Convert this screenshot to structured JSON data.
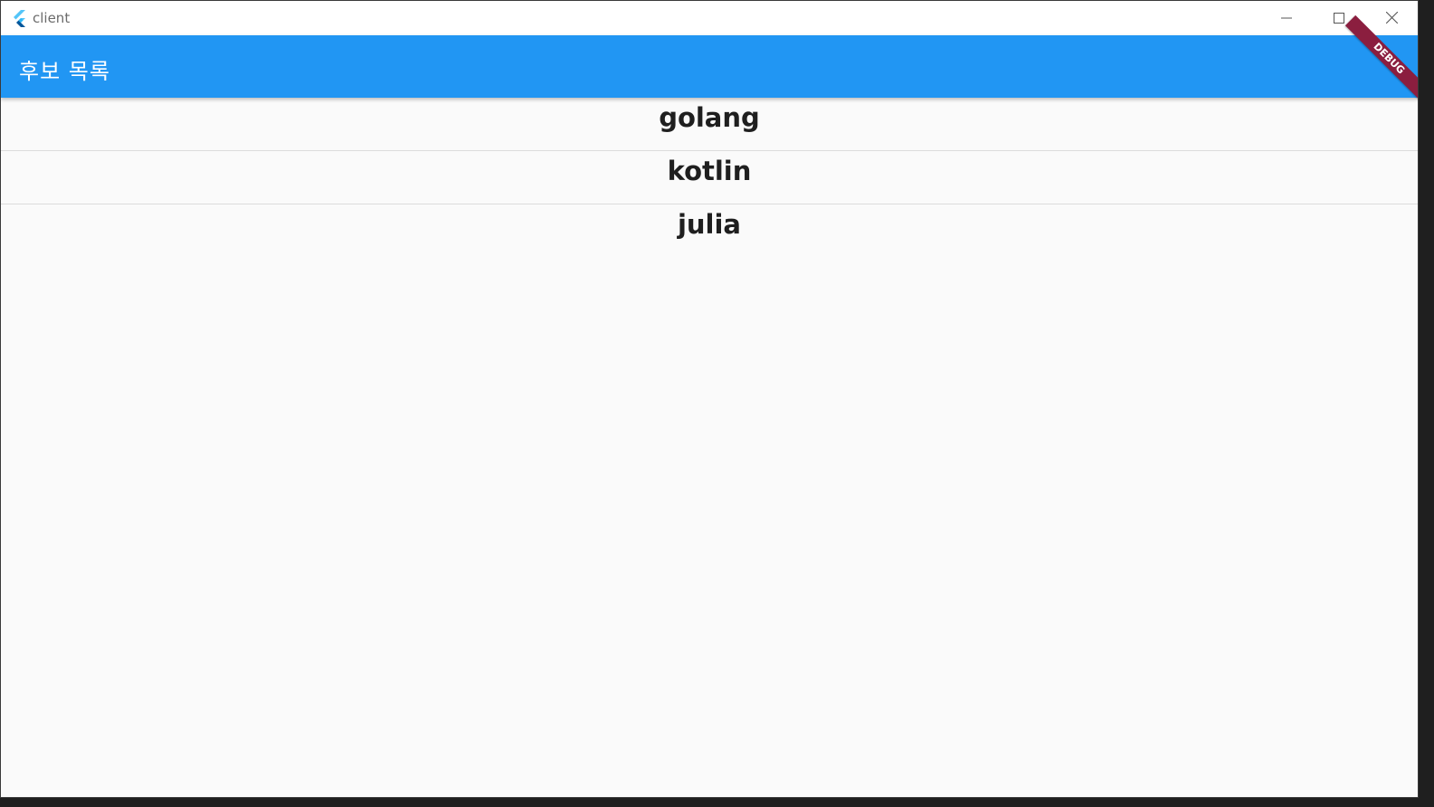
{
  "window": {
    "title": "client",
    "icon": "flutter-logo-icon",
    "controls": [
      "minimize-icon",
      "maximize-icon",
      "close-icon"
    ]
  },
  "appbar": {
    "title": "후보 목록",
    "color": "#2196f3"
  },
  "debug_banner": {
    "label": "DEBUG",
    "color": "#8b1e3f"
  },
  "list": {
    "items": [
      {
        "label": "golang"
      },
      {
        "label": "kotlin"
      },
      {
        "label": "julia"
      }
    ]
  }
}
